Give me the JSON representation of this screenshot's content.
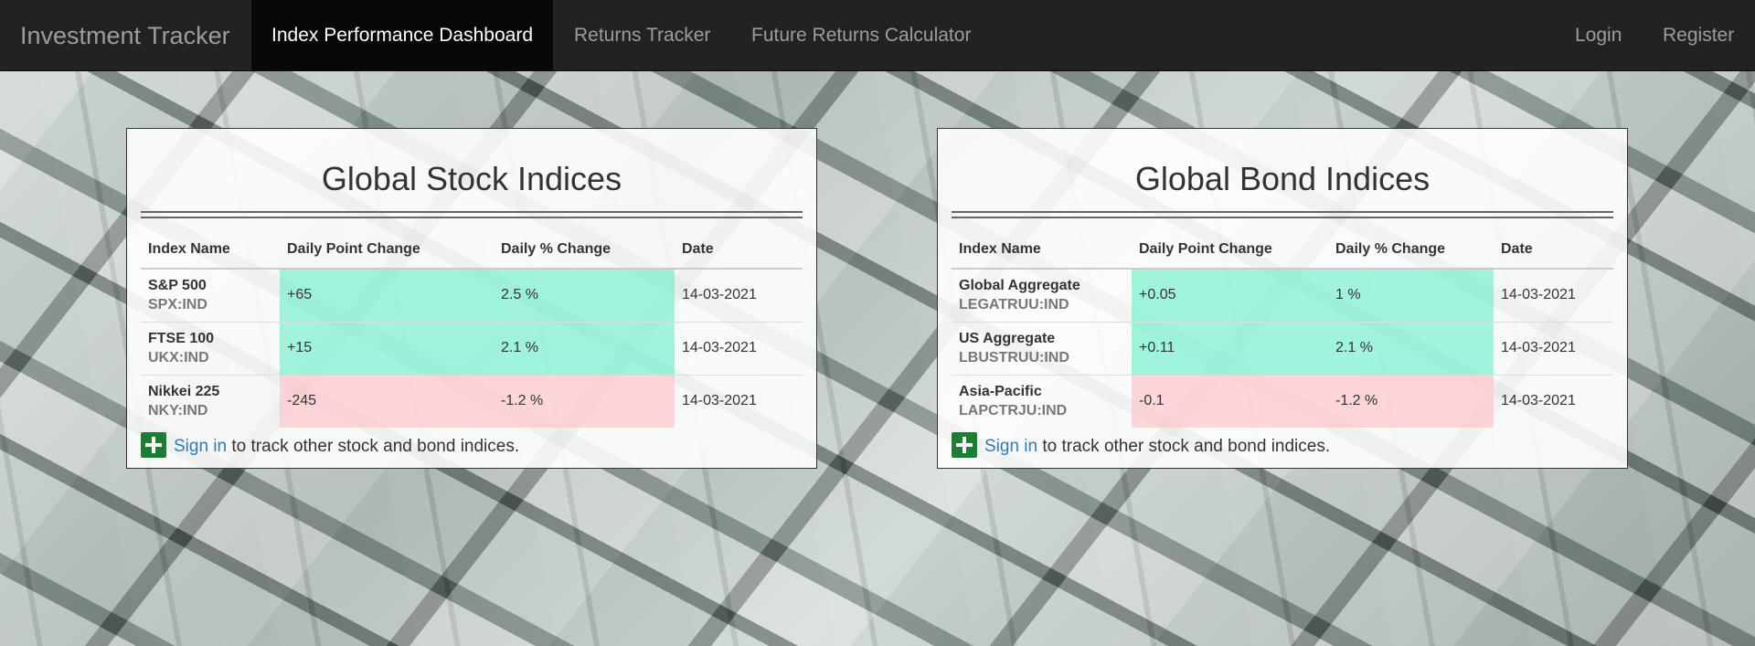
{
  "navbar": {
    "brand": "Investment Tracker",
    "items": [
      {
        "label": "Index Performance Dashboard",
        "active": true
      },
      {
        "label": "Returns Tracker",
        "active": false
      },
      {
        "label": "Future Returns Calculator",
        "active": false
      }
    ],
    "right_items": [
      {
        "label": "Login"
      },
      {
        "label": "Register"
      }
    ]
  },
  "colors": {
    "positive": "#64f0c8",
    "negative": "#ffbec3",
    "nav_bg": "#222222",
    "link": "#337ab7",
    "plus_icon": "#1e7d32"
  },
  "stock_panel": {
    "title": "Global Stock Indices",
    "columns": [
      "Index Name",
      "Daily Point Change",
      "Daily % Change",
      "Date"
    ],
    "rows": [
      {
        "name": "S&P 500",
        "ticker": "SPX:IND",
        "point_change": "+65",
        "pct_change": "2.5 %",
        "date": "14-03-2021",
        "direction": "up"
      },
      {
        "name": "FTSE 100",
        "ticker": "UKX:IND",
        "point_change": "+15",
        "pct_change": "2.1 %",
        "date": "14-03-2021",
        "direction": "up"
      },
      {
        "name": "Nikkei 225",
        "ticker": "NKY:IND",
        "point_change": "-245",
        "pct_change": "-1.2 %",
        "date": "14-03-2021",
        "direction": "down"
      }
    ],
    "footer": {
      "icon": "plus-icon",
      "link_text": "Sign in",
      "text": " to track other stock and bond indices."
    }
  },
  "bond_panel": {
    "title": "Global Bond Indices",
    "columns": [
      "Index Name",
      "Daily Point Change",
      "Daily % Change",
      "Date"
    ],
    "rows": [
      {
        "name": "Global Aggregate",
        "ticker": "LEGATRUU:IND",
        "point_change": "+0.05",
        "pct_change": "1 %",
        "date": "14-03-2021",
        "direction": "up"
      },
      {
        "name": "US Aggregate",
        "ticker": "LBUSTRUU:IND",
        "point_change": "+0.11",
        "pct_change": "2.1 %",
        "date": "14-03-2021",
        "direction": "up"
      },
      {
        "name": "Asia-Pacific",
        "ticker": "LAPCTRJU:IND",
        "point_change": "-0.1",
        "pct_change": "-1.2 %",
        "date": "14-03-2021",
        "direction": "down"
      }
    ],
    "footer": {
      "icon": "plus-icon",
      "link_text": "Sign in",
      "text": " to track other stock and bond indices."
    }
  }
}
